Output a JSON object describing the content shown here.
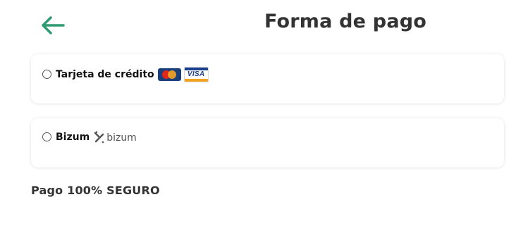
{
  "header": {
    "title": "Forma de pago",
    "back_icon": "arrow-left-icon",
    "accent_color": "#2e9b72"
  },
  "payment_options": [
    {
      "label": "Tarjeta de crédito",
      "selected": false,
      "logos": [
        "mastercard-logo",
        "visa-logo"
      ],
      "visa_text": "VISA"
    },
    {
      "label": "Bizum",
      "selected": false,
      "logos": [
        "bizum-logo"
      ],
      "logo_text": "bizum"
    }
  ],
  "footer": {
    "secure_text": "Pago 100% SEGURO"
  }
}
